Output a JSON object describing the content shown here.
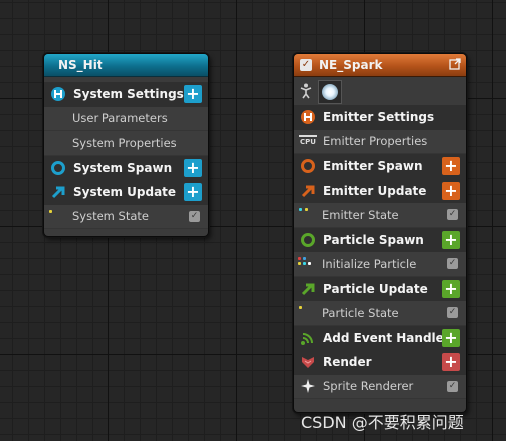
{
  "nodes": {
    "hit": {
      "title": "NS_Hit",
      "rows": [
        {
          "label": "System Settings",
          "kind": "major",
          "icon": "settings-icon",
          "button": "+"
        },
        {
          "label": "User Parameters",
          "kind": "sub"
        },
        {
          "label": "System Properties",
          "kind": "sub"
        },
        {
          "label": "System Spawn",
          "kind": "major",
          "icon": "spawn-ring-icon",
          "button": "+"
        },
        {
          "label": "System Update",
          "kind": "major",
          "icon": "update-arrow-icon",
          "button": "+"
        },
        {
          "label": "System State",
          "kind": "sub",
          "icon": "state-dot-icon",
          "checked": true
        }
      ]
    },
    "spark": {
      "title": "NE_Spark",
      "enabled": true,
      "rows": [
        {
          "label": "Emitter Settings",
          "kind": "major",
          "icon": "settings-icon"
        },
        {
          "label": "Emitter Properties",
          "kind": "sub",
          "icon": "cpu-icon",
          "icon_text": "CPU"
        },
        {
          "label": "Emitter Spawn",
          "kind": "major",
          "icon": "spawn-ring-icon",
          "button": "+"
        },
        {
          "label": "Emitter Update",
          "kind": "major",
          "icon": "update-arrow-icon",
          "button": "+"
        },
        {
          "label": "Emitter State",
          "kind": "sub",
          "icon": "state-dot-icon",
          "checked": true
        },
        {
          "label": "Particle Spawn",
          "kind": "major",
          "icon": "spawn-ring-icon",
          "button": "+"
        },
        {
          "label": "Initialize Particle",
          "kind": "sub",
          "icon": "module-dots-icon",
          "checked": true
        },
        {
          "label": "Particle Update",
          "kind": "major",
          "icon": "update-arrow-icon",
          "button": "+"
        },
        {
          "label": "Particle State",
          "kind": "sub",
          "icon": "state-dot-icon",
          "checked": true
        },
        {
          "label": "Add Event Handler",
          "kind": "major",
          "icon": "event-handler-icon",
          "button": "+"
        },
        {
          "label": "Render",
          "kind": "major",
          "icon": "render-icon",
          "button": "+"
        },
        {
          "label": "Sprite Renderer",
          "kind": "sub",
          "icon": "sprite-icon",
          "checked": true
        }
      ]
    }
  },
  "colors": {
    "system": "#1d9fcc",
    "emitter": "#d8621c",
    "particle": "#5aa62a",
    "render": "#c74a4a"
  },
  "watermark": "CSDN @不要积累问题"
}
